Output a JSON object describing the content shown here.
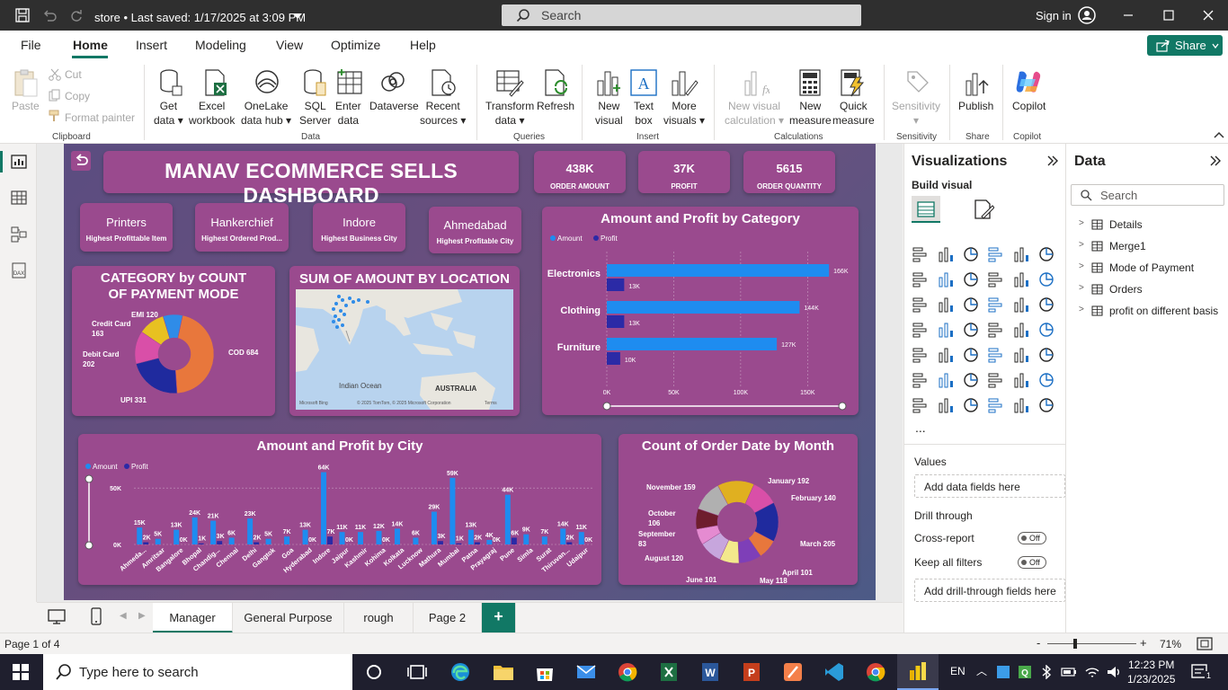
{
  "window": {
    "title": "store • Last saved: 1/17/2025 at 3:09 PM",
    "search_placeholder": "Search",
    "signin": "Sign in"
  },
  "menu": {
    "items": [
      "File",
      "Home",
      "Insert",
      "Modeling",
      "View",
      "Optimize",
      "Help"
    ],
    "active": "Home",
    "share": "Share"
  },
  "ribbon": {
    "clipboard": {
      "paste": "Paste",
      "cut": "Cut",
      "copy": "Copy",
      "format_painter": "Format painter",
      "group": "Clipboard"
    },
    "data": {
      "get_data": [
        "Get",
        "data"
      ],
      "excel": [
        "Excel",
        "workbook"
      ],
      "onelake": [
        "OneLake",
        "data hub"
      ],
      "sql": [
        "SQL",
        "Server"
      ],
      "enter": [
        "Enter",
        "data"
      ],
      "dataverse": "Dataverse",
      "recent": [
        "Recent",
        "sources"
      ],
      "group": "Data"
    },
    "queries": {
      "transform": [
        "Transform",
        "data"
      ],
      "refresh": "Refresh",
      "group": "Queries"
    },
    "insert": {
      "new_visual": [
        "New",
        "visual"
      ],
      "text_box": [
        "Text",
        "box"
      ],
      "more_visuals": [
        "More",
        "visuals"
      ],
      "group": "Insert"
    },
    "calculations": {
      "new_visual_calc": [
        "New visual",
        "calculation"
      ],
      "new_measure": [
        "New",
        "measure"
      ],
      "quick_measure": [
        "Quick",
        "measure"
      ],
      "group": "Calculations"
    },
    "sensitivity": {
      "label": "Sensitivity",
      "group": "Sensitivity"
    },
    "share": {
      "publish": "Publish",
      "group": "Share"
    },
    "copilot": {
      "label": "Copilot",
      "group": "Copilot"
    }
  },
  "report": {
    "title": "MANAV ECOMMERCE SELLS DASHBOARD",
    "kpis": [
      {
        "value": "438K",
        "label": "ORDER AMOUNT"
      },
      {
        "value": "37K",
        "label": "PROFIT"
      },
      {
        "value": "5615",
        "label": "ORDER QUANTITY"
      }
    ],
    "info_cards": [
      {
        "value": "Printers",
        "label": "Highest Profittable Item"
      },
      {
        "value": "Hankerchief",
        "label": "Highest Ordered Prod..."
      },
      {
        "value": "Indore",
        "label": "Highest Business City"
      },
      {
        "value": "Ahmedabad",
        "label": "Highest Profitable City"
      }
    ],
    "payment_title": "CATEGORY by COUNT OF PAYMENT MODE",
    "map_title": "SUM OF AMOUNT BY LOCATION",
    "map_labels": {
      "ocean": "Indian Ocean",
      "country": "AUSTRALIA",
      "credit": "© 2025 TomTom, © 2025 Microsoft Corporation",
      "terms": "Terms",
      "brand": "Microsoft Bing"
    },
    "category_title": "Amount and Profit by Category",
    "city_title": "Amount and Profit by City",
    "month_title": "Count of Order Date by Month",
    "legend": {
      "amount": "Amount",
      "profit": "Profit"
    }
  },
  "chart_data": [
    {
      "type": "pie",
      "title": "CATEGORY by COUNT OF PAYMENT MODE",
      "categories": [
        "COD",
        "UPI",
        "Debit Card",
        "Credit Card",
        "EMI"
      ],
      "values": [
        684,
        331,
        202,
        163,
        120
      ],
      "data_labels": [
        "COD 684",
        "UPI 331",
        "Debit Card 202",
        "Credit Card 163",
        "EMI 120"
      ],
      "colors": [
        "#e8773c",
        "#1f2a9e",
        "#d94fa8",
        "#e8c121",
        "#2f8ce8"
      ]
    },
    {
      "type": "bar",
      "orientation": "horizontal",
      "title": "Amount and Profit by Category",
      "categories": [
        "Electronics",
        "Clothing",
        "Furniture"
      ],
      "series": [
        {
          "name": "Amount",
          "values": [
            166,
            144,
            127
          ],
          "labels": [
            "166K",
            "144K",
            "127K"
          ],
          "color": "#1e8cf0"
        },
        {
          "name": "Profit",
          "values": [
            13,
            13,
            10
          ],
          "labels": [
            "13K",
            "13K",
            "10K"
          ],
          "color": "#2b2aa6"
        }
      ],
      "xticks": [
        "0K",
        "50K",
        "100K",
        "150K"
      ],
      "xlim": [
        0,
        180
      ],
      "legend": "top-left"
    },
    {
      "type": "bar",
      "title": "Amount and Profit by City",
      "categories": [
        "Ahmeda...",
        "Amritsar",
        "Bangalore",
        "Bhopal",
        "Chandig...",
        "Chennai",
        "Delhi",
        "Gangtok",
        "Goa",
        "Hyderabad",
        "Indore",
        "Jaipur",
        "Kashmir",
        "Kohima",
        "Kolkata",
        "Lucknow",
        "Mathura",
        "Mumbai",
        "Patna",
        "Prayagraj",
        "Pune",
        "Simla",
        "Surat",
        "Thiruvan...",
        "Udaipur"
      ],
      "series": [
        {
          "name": "Amount",
          "values": [
            15,
            5,
            13,
            24,
            21,
            6,
            23,
            5,
            7,
            13,
            64,
            11,
            11,
            12,
            14,
            6,
            29,
            59,
            13,
            4,
            44,
            9,
            7,
            14,
            11
          ],
          "labels": [
            "15K",
            "5K",
            "13K",
            "24K",
            "21K",
            "6K",
            "23K",
            "5K",
            "7K",
            "13K",
            "64K",
            "11K",
            "11K",
            "12K",
            "14K",
            "6K",
            "29K",
            "59K",
            "13K",
            "4K",
            "44K",
            "9K",
            "7K",
            "14K",
            "11K"
          ],
          "color": "#1e8cf0"
        },
        {
          "name": "Profit",
          "values": [
            2,
            0,
            0,
            1,
            3,
            0,
            2,
            0,
            0,
            0,
            7,
            0,
            0,
            0,
            0,
            0,
            3,
            1,
            2,
            0,
            6,
            0,
            0,
            2,
            0
          ],
          "labels": [
            "2K",
            "",
            "0K",
            "1K",
            "3K",
            "",
            "2K",
            "",
            "",
            "0K",
            "7K",
            "0K",
            "",
            "0K",
            "",
            "",
            "3K",
            "1K",
            "2K",
            "0K",
            "6K",
            "",
            "",
            "2K",
            "0K"
          ],
          "color": "#2b2aa6"
        }
      ],
      "yticks": [
        "0K",
        "50K"
      ],
      "ylim": [
        0,
        70
      ],
      "legend": "top-left"
    },
    {
      "type": "pie",
      "title": "Count of Order Date by Month",
      "categories": [
        "January",
        "February",
        "March",
        "April",
        "May",
        "June",
        "August",
        "September",
        "October",
        "November"
      ],
      "values": [
        192,
        140,
        205,
        101,
        118,
        101,
        120,
        83,
        106,
        159
      ],
      "data_labels": [
        "January 192",
        "February 140",
        "March 205",
        "April 101",
        "May 118",
        "June 101",
        "August 120",
        "September 83",
        "October 106",
        "November 159"
      ],
      "colors": [
        "#e0b020",
        "#d94fa8",
        "#1f2a9e",
        "#e8773c",
        "#7e3fb8",
        "#f3e98c",
        "#c7a6dd",
        "#e58bd1",
        "#6e1d2d",
        "#b0b0b0"
      ]
    }
  ],
  "panes": {
    "visualizations": {
      "title": "Visualizations",
      "build": "Build visual",
      "values": "Values",
      "add_data": "Add data fields here",
      "drill": "Drill through",
      "cross_report": "Cross-report",
      "keep_filters": "Keep all filters",
      "off": "Off",
      "add_drill": "Add drill-through fields here",
      "more": "..."
    },
    "data": {
      "title": "Data",
      "search_placeholder": "Search",
      "tables": [
        "Details",
        "Merge1",
        "Mode of Payment",
        "Orders",
        "profit on different basis"
      ]
    }
  },
  "tabs": {
    "items": [
      "Manager",
      "General Purpose",
      "rough",
      "Page 2"
    ],
    "active": "Manager",
    "add": "+"
  },
  "status": {
    "page": "Page 1 of 4",
    "zoom": "71%"
  },
  "taskbar": {
    "search_placeholder": "Type here to search",
    "lang": "EN",
    "time": "12:23 PM",
    "date": "1/23/2025",
    "notifications": "1"
  }
}
